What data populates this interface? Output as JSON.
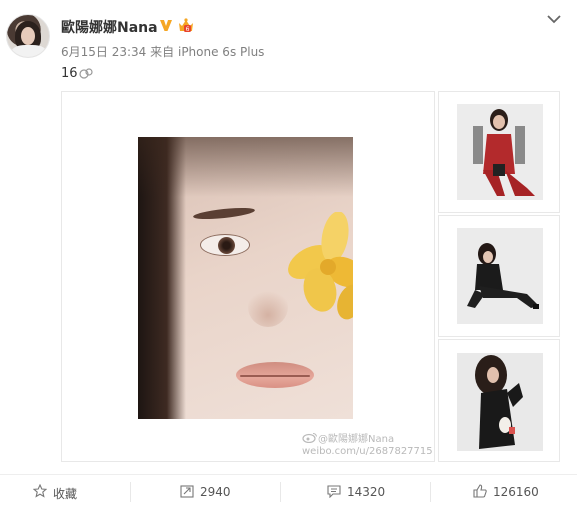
{
  "post": {
    "username": "歐陽娜娜Nana",
    "date": "6月15日 23:34",
    "via_prefix": "来自",
    "device": "iPhone 6s Plus",
    "text": "16",
    "emoji_icon": "sticker-icon"
  },
  "images": {
    "main_alt": "portrait with yellow flower",
    "watermark_user": "@歐陽娜娜Nana",
    "watermark_url": "weibo.com/u/2687827715"
  },
  "actions": {
    "favorite_label": "收藏",
    "forward_count": "2940",
    "comment_count": "14320",
    "like_count": "126160"
  },
  "colors": {
    "verified_badge": "#f5a623",
    "text_primary": "#333333",
    "text_secondary": "#808080"
  }
}
